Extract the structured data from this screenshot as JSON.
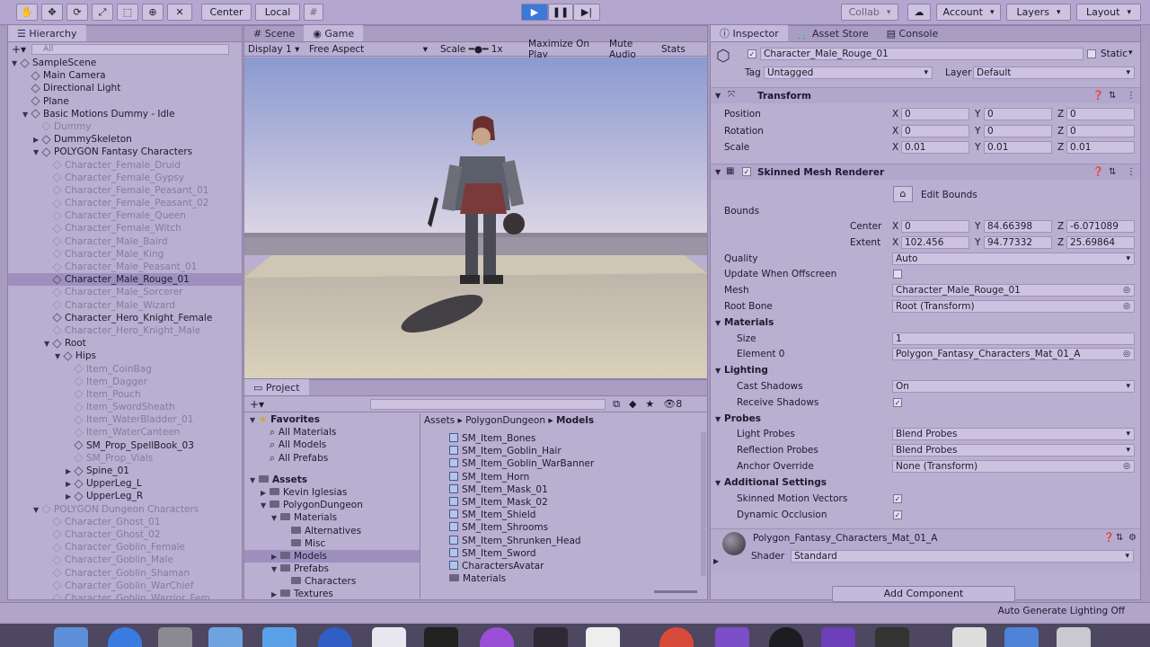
{
  "toolbar": {
    "pivot": "Center",
    "space": "Local",
    "collab": "Collab",
    "account": "Account",
    "layers": "Layers",
    "layout": "Layout"
  },
  "hierarchy": {
    "tab": "Hierarchy",
    "search_placeholder": "All",
    "rows": [
      {
        "label": "SampleScene",
        "indent": 0,
        "arrow": "▼",
        "dim": false
      },
      {
        "label": "Main Camera",
        "indent": 1,
        "arrow": "",
        "dim": false
      },
      {
        "label": "Directional Light",
        "indent": 1,
        "arrow": "",
        "dim": false
      },
      {
        "label": "Plane",
        "indent": 1,
        "arrow": "",
        "dim": false
      },
      {
        "label": "Basic Motions Dummy - Idle",
        "indent": 1,
        "arrow": "▼",
        "dim": false
      },
      {
        "label": "Dummy",
        "indent": 2,
        "arrow": "",
        "dim": true
      },
      {
        "label": "DummySkeleton",
        "indent": 2,
        "arrow": "▶",
        "dim": false
      },
      {
        "label": "POLYGON Fantasy Characters",
        "indent": 2,
        "arrow": "▼",
        "dim": false
      },
      {
        "label": "Character_Female_Druid",
        "indent": 3,
        "arrow": "",
        "dim": true
      },
      {
        "label": "Character_Female_Gypsy",
        "indent": 3,
        "arrow": "",
        "dim": true
      },
      {
        "label": "Character_Female_Peasant_01",
        "indent": 3,
        "arrow": "",
        "dim": true
      },
      {
        "label": "Character_Female_Peasant_02",
        "indent": 3,
        "arrow": "",
        "dim": true
      },
      {
        "label": "Character_Female_Queen",
        "indent": 3,
        "arrow": "",
        "dim": true
      },
      {
        "label": "Character_Female_Witch",
        "indent": 3,
        "arrow": "",
        "dim": true
      },
      {
        "label": "Character_Male_Baird",
        "indent": 3,
        "arrow": "",
        "dim": true
      },
      {
        "label": "Character_Male_King",
        "indent": 3,
        "arrow": "",
        "dim": true
      },
      {
        "label": "Character_Male_Peasant_01",
        "indent": 3,
        "arrow": "",
        "dim": true
      },
      {
        "label": "Character_Male_Rouge_01",
        "indent": 3,
        "arrow": "",
        "dim": false,
        "selected": true
      },
      {
        "label": "Character_Male_Sorcerer",
        "indent": 3,
        "arrow": "",
        "dim": true
      },
      {
        "label": "Character_Male_Wizard",
        "indent": 3,
        "arrow": "",
        "dim": true
      },
      {
        "label": "Character_Hero_Knight_Female",
        "indent": 3,
        "arrow": "",
        "dim": false
      },
      {
        "label": "Character_Hero_Knight_Male",
        "indent": 3,
        "arrow": "",
        "dim": true
      },
      {
        "label": "Root",
        "indent": 3,
        "arrow": "▼",
        "dim": false
      },
      {
        "label": "Hips",
        "indent": 4,
        "arrow": "▼",
        "dim": false
      },
      {
        "label": "Item_CoinBag",
        "indent": 5,
        "arrow": "",
        "dim": true
      },
      {
        "label": "Item_Dagger",
        "indent": 5,
        "arrow": "",
        "dim": true
      },
      {
        "label": "Item_Pouch",
        "indent": 5,
        "arrow": "",
        "dim": true
      },
      {
        "label": "Item_SwordSheath",
        "indent": 5,
        "arrow": "",
        "dim": true
      },
      {
        "label": "Item_WaterBladder_01",
        "indent": 5,
        "arrow": "",
        "dim": true
      },
      {
        "label": "Item_WaterCanteen",
        "indent": 5,
        "arrow": "",
        "dim": true
      },
      {
        "label": "SM_Prop_SpellBook_03",
        "indent": 5,
        "arrow": "",
        "dim": false
      },
      {
        "label": "SM_Prop_Vials",
        "indent": 5,
        "arrow": "",
        "dim": true
      },
      {
        "label": "Spine_01",
        "indent": 5,
        "arrow": "▶",
        "dim": false
      },
      {
        "label": "UpperLeg_L",
        "indent": 5,
        "arrow": "▶",
        "dim": false
      },
      {
        "label": "UpperLeg_R",
        "indent": 5,
        "arrow": "▶",
        "dim": false
      },
      {
        "label": "POLYGON Dungeon Characters",
        "indent": 2,
        "arrow": "▼",
        "dim": true
      },
      {
        "label": "Character_Ghost_01",
        "indent": 3,
        "arrow": "",
        "dim": true
      },
      {
        "label": "Character_Ghost_02",
        "indent": 3,
        "arrow": "",
        "dim": true
      },
      {
        "label": "Character_Goblin_Female",
        "indent": 3,
        "arrow": "",
        "dim": true
      },
      {
        "label": "Character_Goblin_Male",
        "indent": 3,
        "arrow": "",
        "dim": true
      },
      {
        "label": "Character_Goblin_Shaman",
        "indent": 3,
        "arrow": "",
        "dim": true
      },
      {
        "label": "Character_Goblin_WarChief",
        "indent": 3,
        "arrow": "",
        "dim": true
      },
      {
        "label": "Character_Goblin_Warrior_Fem",
        "indent": 3,
        "arrow": "",
        "dim": true
      }
    ]
  },
  "game": {
    "tabs": [
      "Scene",
      "Game"
    ],
    "display": "Display 1",
    "aspect": "Free Aspect",
    "scale_label": "Scale",
    "scale_value": "1x",
    "maximize": "Maximize On Play",
    "mute": "Mute Audio",
    "stats": "Stats"
  },
  "project": {
    "tab": "Project",
    "favorites_label": "Favorites",
    "favorites": [
      "All Materials",
      "All Models",
      "All Prefabs"
    ],
    "assets_label": "Assets",
    "tree": [
      {
        "label": "Kevin Iglesias",
        "indent": 1,
        "arrow": "▶"
      },
      {
        "label": "PolygonDungeon",
        "indent": 1,
        "arrow": "▼"
      },
      {
        "label": "Materials",
        "indent": 2,
        "arrow": "▼"
      },
      {
        "label": "Alternatives",
        "indent": 3,
        "arrow": ""
      },
      {
        "label": "Misc",
        "indent": 3,
        "arrow": ""
      },
      {
        "label": "Models",
        "indent": 2,
        "arrow": "▶",
        "selected": true
      },
      {
        "label": "Prefabs",
        "indent": 2,
        "arrow": "▼"
      },
      {
        "label": "Characters",
        "indent": 3,
        "arrow": ""
      },
      {
        "label": "Textures",
        "indent": 2,
        "arrow": "▶"
      }
    ],
    "breadcrumb": [
      "Assets",
      "PolygonDungeon",
      "Models"
    ],
    "assets": [
      "SM_Item_Bones",
      "SM_Item_Goblin_Hair",
      "SM_Item_Goblin_WarBanner",
      "SM_Item_Horn",
      "SM_Item_Mask_01",
      "SM_Item_Mask_02",
      "SM_Item_Shield",
      "SM_Item_Shrooms",
      "SM_Item_Shrunken_Head",
      "SM_Item_Sword",
      "CharactersAvatar",
      "Materials"
    ],
    "count_badge": "8"
  },
  "inspector": {
    "tabs": [
      "Inspector",
      "Asset Store",
      "Console"
    ],
    "object_name": "Character_Male_Rouge_01",
    "static_label": "Static",
    "tag_label": "Tag",
    "tag_value": "Untagged",
    "layer_label": "Layer",
    "layer_value": "Default",
    "transform": {
      "title": "Transform",
      "position_label": "Position",
      "rotation_label": "Rotation",
      "scale_label": "Scale",
      "position": [
        "0",
        "0",
        "0"
      ],
      "rotation": [
        "0",
        "0",
        "0"
      ],
      "scale": [
        "0.01",
        "0.01",
        "0.01"
      ]
    },
    "smr": {
      "title": "Skinned Mesh Renderer",
      "edit_bounds": "Edit Bounds",
      "bounds_label": "Bounds",
      "center_label": "Center",
      "extent_label": "Extent",
      "center": [
        "0",
        "84.66398",
        "-6.071089"
      ],
      "extent": [
        "102.456",
        "94.77332",
        "25.69864"
      ],
      "quality_label": "Quality",
      "quality_value": "Auto",
      "update_offscreen_label": "Update When Offscreen",
      "mesh_label": "Mesh",
      "mesh_value": "Character_Male_Rouge_01",
      "root_bone_label": "Root Bone",
      "root_bone_value": "Root (Transform)",
      "materials_label": "Materials",
      "size_label": "Size",
      "size_value": "1",
      "element0_label": "Element 0",
      "element0_value": "Polygon_Fantasy_Characters_Mat_01_A",
      "lighting_label": "Lighting",
      "cast_shadows_label": "Cast Shadows",
      "cast_shadows_value": "On",
      "receive_shadows_label": "Receive Shadows",
      "probes_label": "Probes",
      "light_probes_label": "Light Probes",
      "light_probes_value": "Blend Probes",
      "reflection_probes_label": "Reflection Probes",
      "reflection_probes_value": "Blend Probes",
      "anchor_override_label": "Anchor Override",
      "anchor_override_value": "None (Transform)",
      "additional_label": "Additional Settings",
      "skinned_motion_label": "Skinned Motion Vectors",
      "dynamic_occlusion_label": "Dynamic Occlusion"
    },
    "material": {
      "name": "Polygon_Fantasy_Characters_Mat_01_A",
      "shader_label": "Shader",
      "shader_value": "Standard"
    },
    "add_component": "Add Component"
  },
  "status": {
    "right": "Auto Generate Lighting Off"
  },
  "colors": {
    "accent_play": "#3c78d8",
    "selection": "#9d8fbe"
  }
}
